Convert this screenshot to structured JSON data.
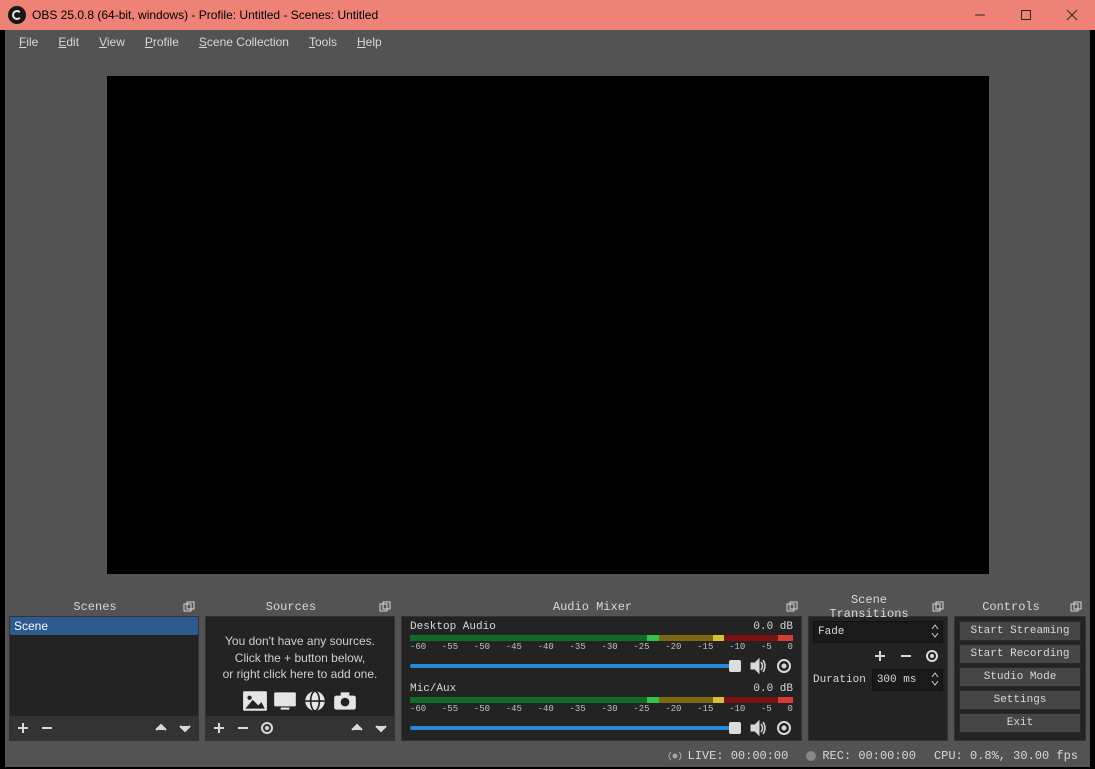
{
  "title": "OBS 25.0.8 (64-bit, windows) - Profile: Untitled - Scenes: Untitled",
  "menu": {
    "file": "File",
    "edit": "Edit",
    "view": "View",
    "profile": "Profile",
    "scene_collection": "Scene Collection",
    "tools": "Tools",
    "help": "Help"
  },
  "docks": {
    "scenes": {
      "title": "Scenes",
      "items": [
        "Scene"
      ]
    },
    "sources": {
      "title": "Sources",
      "empty_l1": "You don't have any sources.",
      "empty_l2": "Click the + button below,",
      "empty_l3": "or right click here to add one."
    },
    "mixer": {
      "title": "Audio Mixer",
      "ticks": [
        "-60",
        "-55",
        "-50",
        "-45",
        "-40",
        "-35",
        "-30",
        "-25",
        "-20",
        "-15",
        "-10",
        "-5",
        "0"
      ],
      "channels": [
        {
          "name": "Desktop Audio",
          "db": "0.0 dB"
        },
        {
          "name": "Mic/Aux",
          "db": "0.0 dB"
        }
      ]
    },
    "trans": {
      "title": "Scene Transitions",
      "current": "Fade",
      "duration_label": "Duration",
      "duration_value": "300 ms"
    },
    "controls": {
      "title": "Controls",
      "buttons": [
        "Start Streaming",
        "Start Recording",
        "Studio Mode",
        "Settings",
        "Exit"
      ]
    }
  },
  "status": {
    "live": "LIVE: 00:00:00",
    "rec": "REC: 00:00:00",
    "cpu": "CPU: 0.8%, 30.00 fps"
  }
}
